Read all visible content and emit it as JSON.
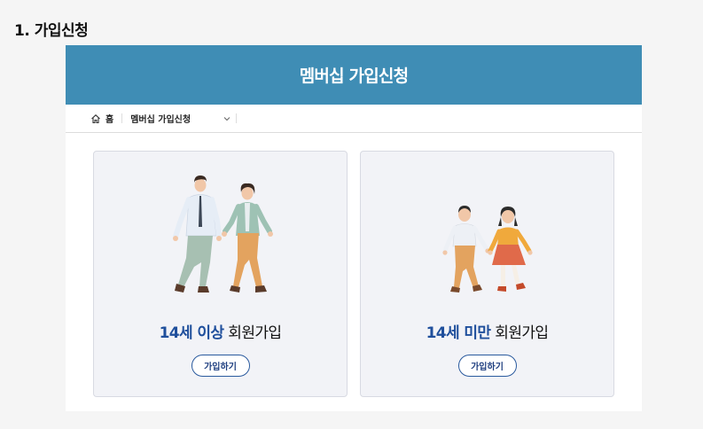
{
  "section_title": "1. 가입신청",
  "banner": {
    "title": "멤버십 가입신청"
  },
  "breadcrumb": {
    "home_label": "홈",
    "current": "멤버십 가입신청"
  },
  "cards": [
    {
      "highlight": "14세 이상",
      "rest": " 회원가입",
      "button": "가입하기"
    },
    {
      "highlight": "14세 미만",
      "rest": " 회원가입",
      "button": "가입하기"
    }
  ],
  "colors": {
    "banner": "#3f8db5",
    "accent": "#1f4f9c"
  }
}
